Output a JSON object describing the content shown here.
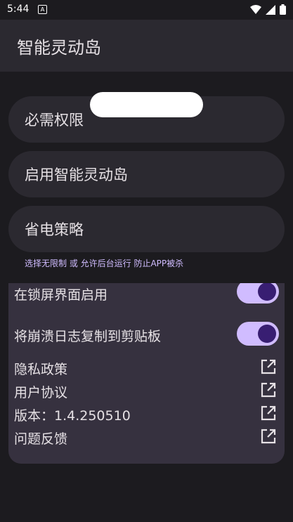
{
  "status_bar": {
    "time": "5:44",
    "notification_icon_text": "A",
    "icons": [
      "wifi-icon",
      "signal-icon",
      "battery-icon"
    ]
  },
  "app_bar": {
    "title": "智能灵动岛"
  },
  "cards": [
    {
      "label": "必需权限"
    },
    {
      "label": "启用智能灵动岛"
    },
    {
      "label": "省电策略"
    }
  ],
  "hint_text": "选择无限制 或 允许后台运行 防止APP被杀",
  "settings": {
    "lock_screen": {
      "label": "在锁屏界面启用",
      "enabled": true
    },
    "crash_log": {
      "label": "将崩溃日志复制到剪贴板",
      "enabled": true
    },
    "privacy": {
      "label": "隐私政策",
      "icon": "open-in-new-icon"
    },
    "user_agreement": {
      "label": "用户协议",
      "icon": "open-in-new-icon"
    },
    "version": {
      "label": "版本：1.4.250510",
      "icon": "open-in-new-icon"
    },
    "feedback": {
      "label": "问题反馈",
      "icon": "open-in-new-icon"
    }
  },
  "colors": {
    "background": "#1c1b1f",
    "surface": "#2b2930",
    "panel": "#36313f",
    "accent": "#d0bcff",
    "accent_dark": "#381e72"
  }
}
